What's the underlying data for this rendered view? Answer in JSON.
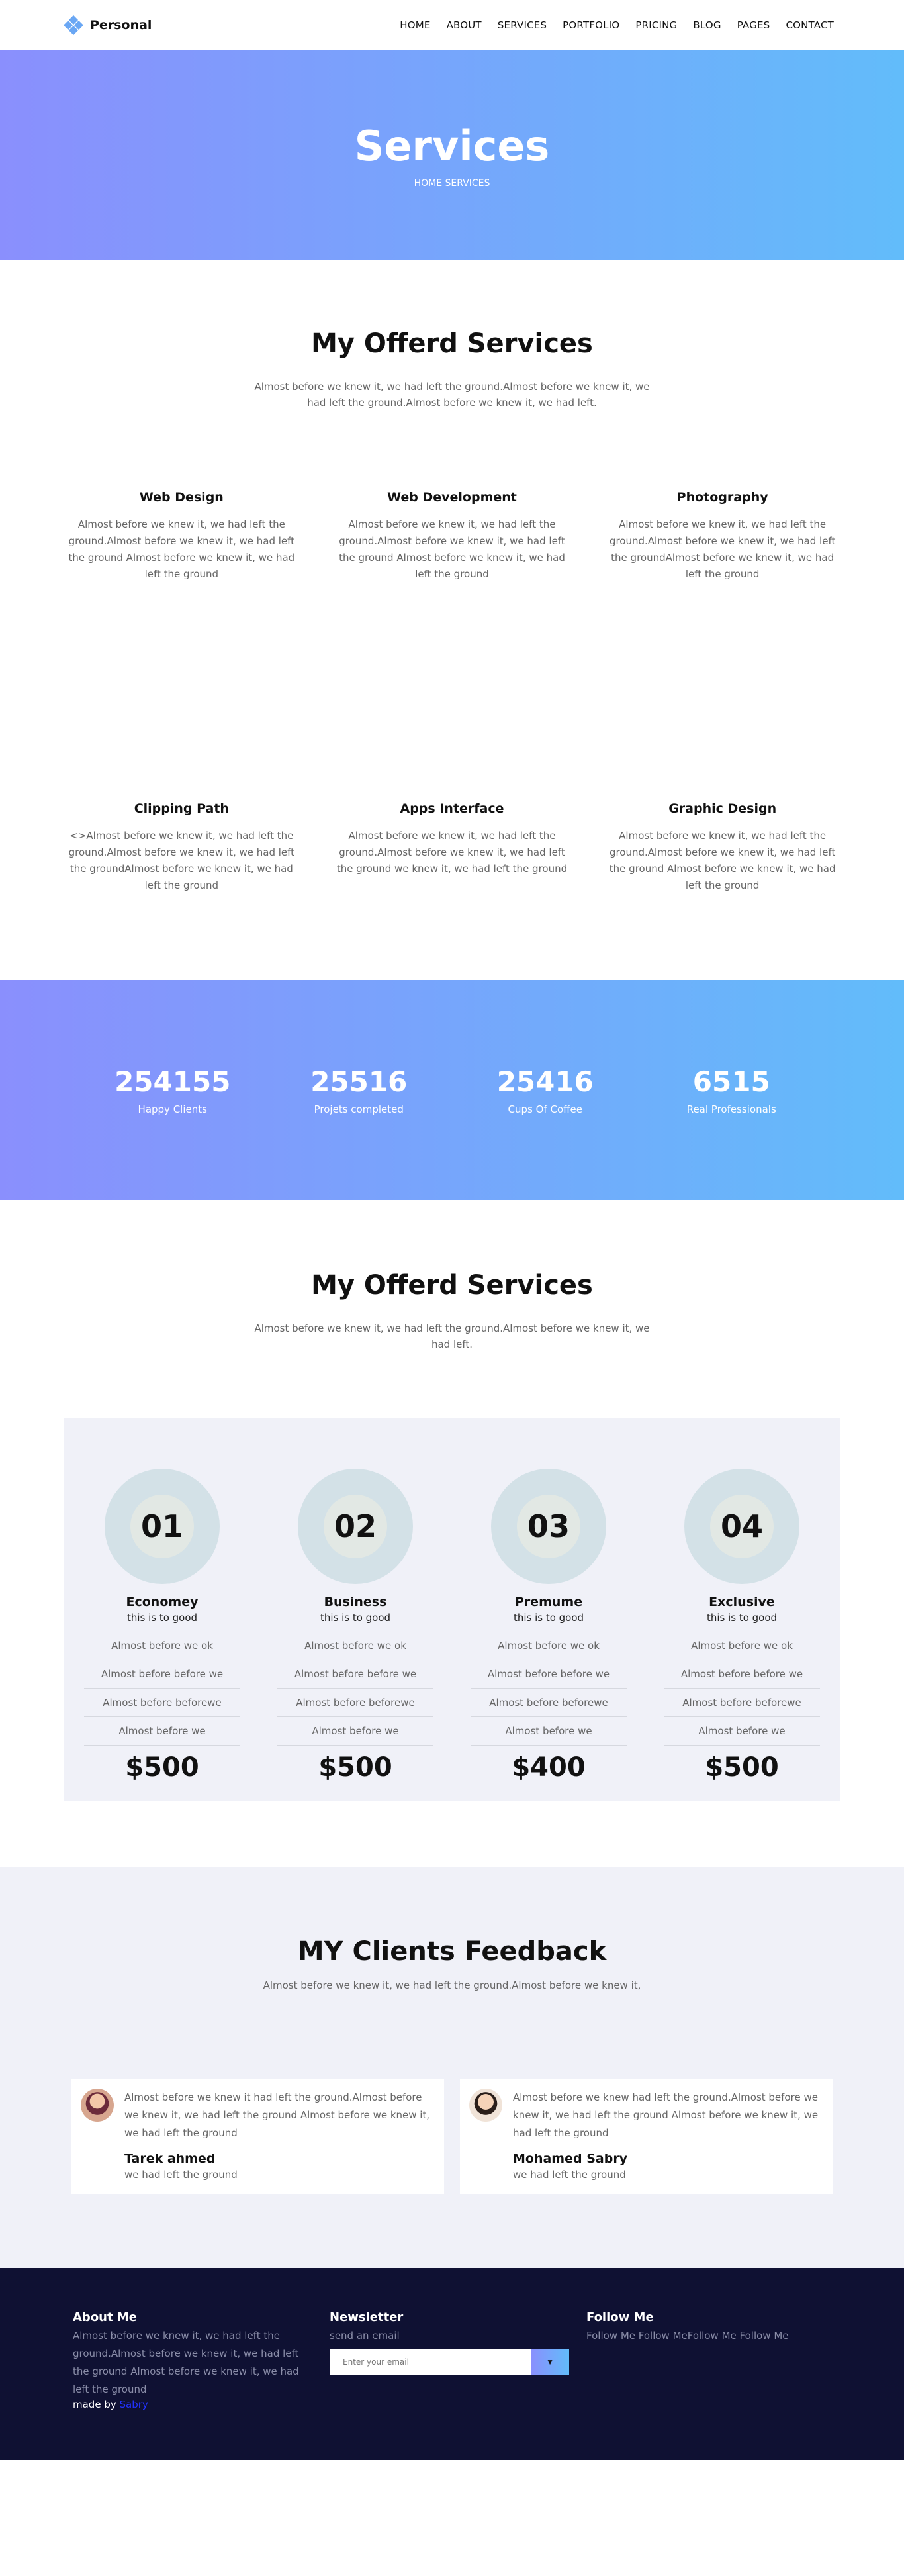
{
  "nav": {
    "brand": "Personal",
    "menu": [
      "HOME",
      "ABOUT",
      "SERVICES",
      "PORTFOLIO",
      "PRICING",
      "BLOG",
      "PAGES",
      "CONTACT"
    ]
  },
  "hero": {
    "title": "Services",
    "breadcrumb": "HOME SERVICES"
  },
  "services": {
    "title": "My Offerd Services",
    "subtitle": "Almost before we knew it, we had left the ground.Almost before we knew it, we had left the ground.Almost before we knew it, we had left.",
    "items": [
      {
        "title": "Web Design",
        "text": "Almost before we knew it, we had left the ground.Almost before we knew it, we had left the ground Almost before we knew it, we had left the ground"
      },
      {
        "title": "Web Development",
        "text": "Almost before we knew it, we had left the ground.Almost before we knew it, we had left the ground Almost before we knew it, we had left the ground"
      },
      {
        "title": "Photography",
        "text": "Almost before we knew it, we had left the ground.Almost before we knew it, we had left the groundAlmost before we knew it, we had left the ground"
      },
      {
        "title": "Clipping Path",
        "text": "<>Almost before we knew it, we had left the ground.Almost before we knew it, we had left the groundAlmost before we knew it, we had left the ground"
      },
      {
        "title": "Apps Interface",
        "text": "Almost before we knew it, we had left the ground.Almost before we knew it, we had left the ground we knew it, we had left the ground"
      },
      {
        "title": "Graphic Design",
        "text": "Almost before we knew it, we had left the ground.Almost before we knew it, we had left the ground Almost before we knew it, we had left the ground"
      }
    ]
  },
  "counters": [
    {
      "value": "254155",
      "label": "Happy Clients"
    },
    {
      "value": "25516",
      "label": "Projets completed"
    },
    {
      "value": "25416",
      "label": "Cups Of Coffee"
    },
    {
      "value": "6515",
      "label": "Real Professionals"
    }
  ],
  "pricing": {
    "title": "My Offerd Services",
    "subtitle": "Almost before we knew it, we had left the ground.Almost before we knew it, we had left.",
    "plans": [
      {
        "number": "01",
        "name": "Economey",
        "sub": "this is to good",
        "features": [
          "Almost before we ok",
          "Almost before before we",
          "Almost before beforewe",
          "Almost before we"
        ],
        "price": "$500"
      },
      {
        "number": "02",
        "name": "Business",
        "sub": "this is to good",
        "features": [
          "Almost before we ok",
          "Almost before before we",
          "Almost before beforewe",
          "Almost before we"
        ],
        "price": "$500"
      },
      {
        "number": "03",
        "name": "Premume",
        "sub": "this is to good",
        "features": [
          "Almost before we ok",
          "Almost before before we",
          "Almost before beforewe",
          "Almost before we"
        ],
        "price": "$400"
      },
      {
        "number": "04",
        "name": "Exclusive",
        "sub": "this is to good",
        "features": [
          "Almost before we ok",
          "Almost before before we",
          "Almost before beforewe",
          "Almost before we"
        ],
        "price": "$500"
      }
    ]
  },
  "feedback": {
    "title": "MY Clients Feedback",
    "subtitle": "Almost before we knew it, we had left the ground.Almost before we knew it,",
    "cards": [
      {
        "text": "Almost before we knew it had left the ground.Almost before we knew it, we had left the ground Almost before we knew it, we had left the ground",
        "name": "Tarek ahmed",
        "role": "we had left the ground"
      },
      {
        "text": "Almost before we knew had left the ground.Almost before we knew it, we had left the ground Almost before we knew it, we had left the ground",
        "name": "Mohamed Sabry",
        "role": "we had left the ground"
      }
    ]
  },
  "footer": {
    "about_title": "About Me",
    "about_text": "Almost before we knew it, we had left the ground.Almost before we knew it, we had left the ground Almost before we knew it, we had left the ground",
    "made_by": "made by",
    "made_link": "Sabry",
    "newsletter_title": "Newsletter",
    "newsletter_text": "send an email",
    "email_placeholder": "Enter your email",
    "submit_icon": "▼",
    "follow_title": "Follow Me",
    "follow_text": "Follow Me Follow MeFollow Me Follow Me"
  },
  "colors": {
    "gradient_start": "#8a8ffd",
    "gradient_end": "#62bcfa",
    "footer_bg": "#0f1133",
    "pricing_bg": "#f0f1f8"
  }
}
